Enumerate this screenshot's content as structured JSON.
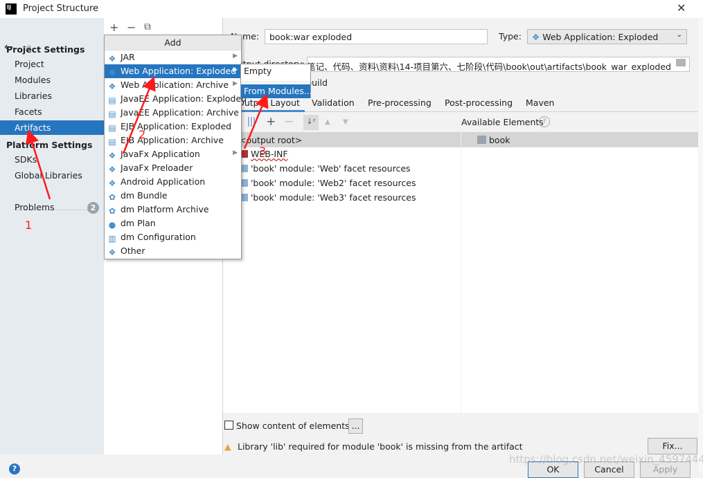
{
  "window": {
    "title": "Project Structure",
    "close": "✕",
    "logo": "IJ"
  },
  "sidebar": {
    "back": "←",
    "forward": "→",
    "project_settings": "Project Settings",
    "items": [
      "Project",
      "Modules",
      "Libraries",
      "Facets",
      "Artifacts"
    ],
    "platform_settings": "Platform Settings",
    "platform_items": [
      "SDKs",
      "Global Libraries"
    ],
    "problems": "Problems",
    "problems_count": "2",
    "selected": "Artifacts"
  },
  "middle_toolbar": {
    "add": "+",
    "remove": "−",
    "copy": "⧉"
  },
  "add_menu": {
    "header": "Add",
    "items": [
      {
        "label": "JAR",
        "icon": "diamond-icon",
        "submenu": true
      },
      {
        "label": "Web Application: Exploded",
        "icon": "web-icon",
        "submenu": true,
        "selected": true
      },
      {
        "label": "Web Application: Archive",
        "icon": "web-icon",
        "submenu": true
      },
      {
        "label": "JavaEE Application: Exploded",
        "icon": "javaee-icon"
      },
      {
        "label": "JavaEE Application: Archive",
        "icon": "javaee-icon"
      },
      {
        "label": "EJB Application: Exploded",
        "icon": "ejb-icon"
      },
      {
        "label": "EJB Application: Archive",
        "icon": "ejb-icon"
      },
      {
        "label": "JavaFx Application",
        "icon": "diamond-icon",
        "submenu": true
      },
      {
        "label": "JavaFx Preloader",
        "icon": "diamond-icon"
      },
      {
        "label": "Android Application",
        "icon": "diamond-icon"
      },
      {
        "label": "dm Bundle",
        "icon": "dm-icon"
      },
      {
        "label": "dm Platform Archive",
        "icon": "dm-icon"
      },
      {
        "label": "dm Plan",
        "icon": "dm-plan-icon"
      },
      {
        "label": "dm Configuration",
        "icon": "file-icon"
      },
      {
        "label": "Other",
        "icon": "diamond-icon"
      }
    ]
  },
  "submenu": {
    "items": [
      "Empty",
      "From Modules..."
    ],
    "selected": "From Modules..."
  },
  "artifact": {
    "name_label": "Name:",
    "name_value": "book:war exploded",
    "type_label": "Type:",
    "type_value": "Web Application: Exploded",
    "output_dir_label": "Output directory:",
    "output_dir_value": "己\\笔记、代码、资料\\资料\\14-项目第六、七阶段\\代码\\book\\out\\artifacts\\book_war_exploded",
    "include_build": "Include in project build"
  },
  "tabs": [
    "Output Layout",
    "Validation",
    "Pre-processing",
    "Post-processing",
    "Maven"
  ],
  "active_tab": "Output Layout",
  "layout": {
    "available_label": "Available Elements",
    "root": "<output root>",
    "tree": [
      "WEB-INF",
      "'book' module: 'Web' facet resources",
      "'book' module: 'Web2' facet resources",
      "'book' module: 'Web3' facet resources"
    ],
    "available": [
      "book"
    ]
  },
  "show_content": {
    "label": "Show content of elements",
    "checked": false,
    "more": "..."
  },
  "warning": {
    "text": "Library 'lib' required for module 'book' is missing from the artifact",
    "fix": "Fix..."
  },
  "buttons": {
    "ok": "OK",
    "cancel": "Cancel",
    "apply": "Apply",
    "help": "?"
  },
  "annotations": [
    "1",
    "2",
    "3"
  ],
  "watermark": "https://blog.csdn.net/weixin_45974445",
  "colors": {
    "selection": "#2675bf",
    "annotation": "#ff1a1a"
  }
}
